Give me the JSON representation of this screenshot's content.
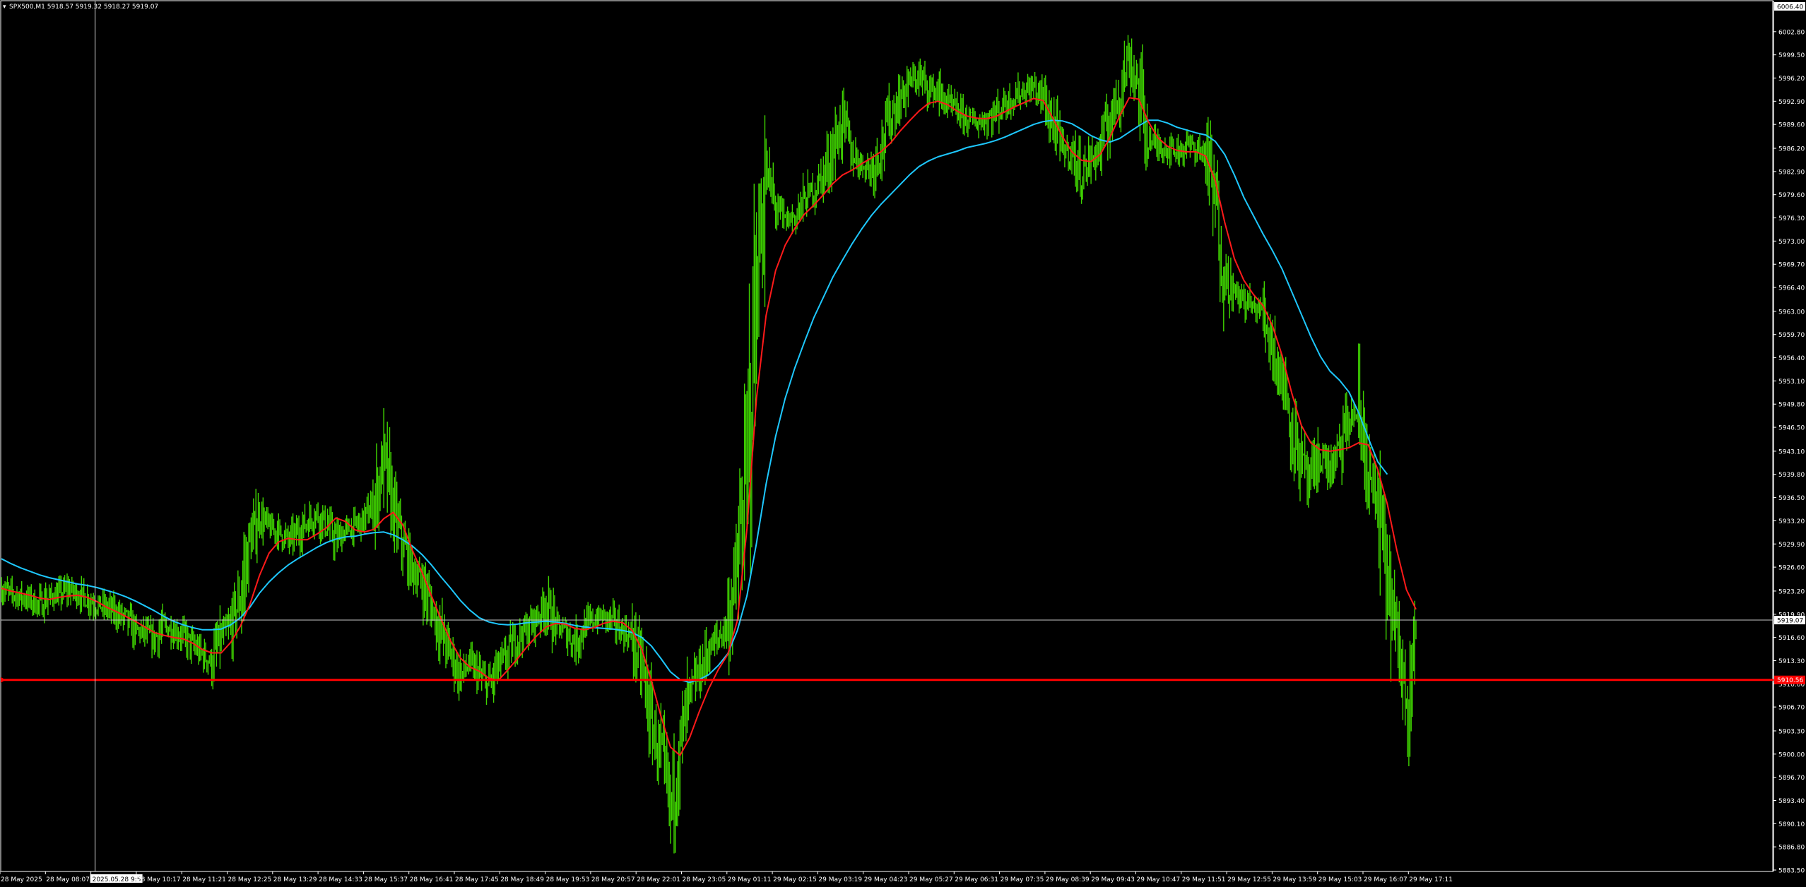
{
  "window": {
    "symbol_title": "SPX500,M1  5918.57 5919.32 5918.27 5919.07",
    "menu_glyph": "▾"
  },
  "colors": {
    "background": "#000000",
    "frame": "#ffffff",
    "candles": "#3fd400",
    "ma_fast": "#ff1a1a",
    "ma_slow": "#1ec8ff",
    "level_line": "#ff0000",
    "crosshair": "#d8d8d8"
  },
  "chart_data": {
    "type": "line",
    "title": "",
    "xlabel": "",
    "ylabel": "",
    "ylim": [
      5883.5,
      6006.4
    ],
    "grid": false,
    "y_ticks": [
      "6002.80",
      "5999.50",
      "5996.20",
      "5992.90",
      "5989.60",
      "5986.20",
      "5982.90",
      "5979.60",
      "5976.30",
      "5973.00",
      "5969.70",
      "5966.40",
      "5963.00",
      "5959.70",
      "5956.40",
      "5953.10",
      "5949.80",
      "5946.50",
      "5943.10",
      "5939.80",
      "5936.50",
      "5933.20",
      "5929.90",
      "5926.60",
      "5923.20",
      "5919.90",
      "5916.60",
      "5913.30",
      "5910.00",
      "5906.70",
      "5903.30",
      "5900.00",
      "5896.70",
      "5893.40",
      "5890.10",
      "5886.80",
      "5883.50"
    ],
    "x_ticks": [
      "28 May 2025",
      "28 May 08:07",
      "2025.05.28 9:51",
      "28 May 10:17",
      "28 May 11:21",
      "28 May 12:25",
      "28 May 13:29",
      "28 May 14:33",
      "28 May 15:37",
      "28 May 16:41",
      "28 May 17:45",
      "28 May 18:49",
      "28 May 19:53",
      "28 May 20:57",
      "28 May 22:01",
      "28 May 23:05",
      "29 May 01:11",
      "29 May 02:15",
      "29 May 03:19",
      "29 May 04:23",
      "29 May 05:27",
      "29 May 06:31",
      "29 May 07:35",
      "29 May 08:39",
      "29 May 09:43",
      "29 May 10:47",
      "29 May 11:51",
      "29 May 12:55",
      "29 May 13:59",
      "29 May 15:03",
      "29 May 16:07",
      "29 May 17:11"
    ],
    "crosshair_time_label": "2025.05.28 9:51",
    "top_price_label": "6006.40",
    "current_price_label": "5919.07",
    "level_price_label": "5910.56",
    "series": [
      {
        "name": "price",
        "values": [
          5923.5,
          5922.8,
          5922.4,
          5921.9,
          5921.2,
          5922.4,
          5922.6,
          5923.4,
          5922.8,
          5922.1,
          5921.3,
          5920.8,
          5920.1,
          5919.2,
          5917.6,
          5917.2,
          5916.4,
          5918.2,
          5917.6,
          5916.8,
          5915.4,
          5914.2,
          5913.1,
          5916.6,
          5918.2,
          5922.4,
          5930.2,
          5933.8,
          5932.2,
          5931.6,
          5930.4,
          5931.5,
          5933.1,
          5934.2,
          5932.6,
          5930.5,
          5931.8,
          5932.4,
          5933.4,
          5935.6,
          5941.8,
          5934.6,
          5929.8,
          5926.2,
          5924.4,
          5920.8,
          5917.4,
          5914.3,
          5911.2,
          5912.8,
          5911.2,
          5909.6,
          5912.4,
          5914.2,
          5916.6,
          5917.8,
          5919.4,
          5921.3,
          5918.2,
          5917.4,
          5915.9,
          5918.1,
          5919.2,
          5919.6,
          5918.8,
          5917.5,
          5916.6,
          5912.2,
          5904.5,
          5899.4,
          5892.3,
          5901.3,
          5908.2,
          5911.5,
          5914.7,
          5916.5,
          5918.6,
          5926.2,
          5940.6,
          5966.5,
          5982.6,
          5977.8,
          5975.8,
          5976.6,
          5978.8,
          5980.4,
          5982.4,
          5985.9,
          5990.1,
          5985.4,
          5984.1,
          5983.2,
          5986.4,
          5990.6,
          5993.2,
          5995.6,
          5996.3,
          5994.8,
          5994.2,
          5992.4,
          5991.3,
          5990.5,
          5989.8,
          5990.3,
          5991.2,
          5992.6,
          5993.6,
          5994.4,
          5994.8,
          5993.4,
          5989.6,
          5986.2,
          5985.3,
          5982.4,
          5984.6,
          5986.2,
          5990.5,
          5994.5,
          5999.1,
          5994.6,
          5987.5,
          5986.4,
          5986.2,
          5985.8,
          5986.7,
          5986.2,
          5985.4,
          5978.4,
          5968.4,
          5965.4,
          5964.8,
          5963.4,
          5963.2,
          5958.1,
          5953.3,
          5946.8,
          5941.6,
          5937.8,
          5942.6,
          5940.4,
          5943.1,
          5947.5,
          5948.6,
          5940.2,
          5934.8,
          5925.2,
          5915.6,
          5908.6,
          5919.07
        ]
      },
      {
        "name": "ma_fast",
        "values": [
          5923.6,
          5923.2,
          5922.9,
          5922.6,
          5922.2,
          5922.0,
          5922.3,
          5922.5,
          5922.6,
          5922.3,
          5921.7,
          5920.9,
          5920.3,
          5919.6,
          5918.9,
          5918.1,
          5917.3,
          5916.9,
          5916.6,
          5916.4,
          5915.8,
          5914.9,
          5914.4,
          5914.4,
          5915.9,
          5918.2,
          5921.3,
          5925.4,
          5928.6,
          5930.2,
          5930.7,
          5930.5,
          5930.5,
          5931.3,
          5932.2,
          5933.6,
          5933.1,
          5931.9,
          5931.6,
          5932.0,
          5933.5,
          5934.4,
          5932.6,
          5929.0,
          5925.9,
          5922.5,
          5919.2,
          5916.1,
          5913.7,
          5912.4,
          5911.8,
          5910.8,
          5910.5,
          5912.0,
          5913.6,
          5915.3,
          5916.8,
          5918.1,
          5918.6,
          5918.5,
          5917.9,
          5917.7,
          5918.0,
          5918.6,
          5918.9,
          5918.7,
          5917.6,
          5914.9,
          5910.5,
          5905.4,
          5901.0,
          5899.8,
          5902.3,
          5906.0,
          5909.3,
          5912.0,
          5914.2,
          5919.0,
          5932.0,
          5950.6,
          5962.4,
          5968.8,
          5972.4,
          5974.8,
          5976.8,
          5978.1,
          5979.6,
          5981.2,
          5982.4,
          5983.1,
          5984.0,
          5984.8,
          5985.7,
          5986.9,
          5988.6,
          5990.1,
          5991.5,
          5992.6,
          5992.9,
          5992.4,
          5991.5,
          5990.8,
          5990.5,
          5990.4,
          5990.7,
          5991.4,
          5992.1,
          5992.7,
          5993.3,
          5993.0,
          5990.5,
          5987.9,
          5985.7,
          5984.5,
          5984.3,
          5985.4,
          5987.8,
          5990.8,
          5993.4,
          5993.2,
          5990.0,
          5987.7,
          5986.5,
          5985.9,
          5985.7,
          5985.7,
          5985.1,
          5981.6,
          5975.6,
          5970.5,
          5967.4,
          5965.4,
          5963.8,
          5960.9,
          5956.7,
          5951.4,
          5946.8,
          5944.3,
          5943.3,
          5943.1,
          5943.3,
          5943.6,
          5944.3,
          5944.0,
          5940.5,
          5935.6,
          5929.0,
          5923.4,
          5920.6
        ]
      },
      {
        "name": "ma_slow",
        "values": [
          5927.8,
          5927.1,
          5926.5,
          5926.0,
          5925.5,
          5925.1,
          5924.8,
          5924.5,
          5924.2,
          5924.0,
          5923.7,
          5923.3,
          5922.9,
          5922.4,
          5921.8,
          5921.1,
          5920.4,
          5919.6,
          5918.9,
          5918.4,
          5918.0,
          5917.7,
          5917.7,
          5917.8,
          5918.4,
          5919.4,
          5920.9,
          5922.9,
          5924.5,
          5925.8,
          5926.9,
          5927.8,
          5928.6,
          5929.4,
          5930.1,
          5930.6,
          5930.9,
          5931.0,
          5931.3,
          5931.5,
          5931.6,
          5931.2,
          5930.5,
          5929.6,
          5928.4,
          5926.9,
          5925.2,
          5923.6,
          5921.9,
          5920.5,
          5919.4,
          5918.8,
          5918.5,
          5918.4,
          5918.5,
          5918.7,
          5918.8,
          5918.9,
          5918.8,
          5918.6,
          5918.3,
          5918.1,
          5918.0,
          5917.9,
          5917.8,
          5917.6,
          5917.3,
          5916.6,
          5915.4,
          5913.6,
          5911.7,
          5910.6,
          5910.2,
          5910.6,
          5911.3,
          5912.6,
          5914.3,
          5917.6,
          5922.5,
          5930.0,
          5938.4,
          5945.2,
          5950.6,
          5954.9,
          5958.6,
          5962.1,
          5965.0,
          5967.9,
          5970.3,
          5972.6,
          5974.7,
          5976.6,
          5978.2,
          5979.6,
          5981.0,
          5982.4,
          5983.6,
          5984.4,
          5985.0,
          5985.4,
          5985.8,
          5986.3,
          5986.6,
          5986.9,
          5987.3,
          5987.8,
          5988.4,
          5989.0,
          5989.6,
          5990.0,
          5990.2,
          5990.1,
          5989.7,
          5988.9,
          5988.0,
          5987.4,
          5987.1,
          5987.6,
          5988.5,
          5989.4,
          5990.2,
          5990.2,
          5989.8,
          5989.2,
          5988.8,
          5988.4,
          5988.1,
          5987.2,
          5985.3,
          5982.4,
          5979.2,
          5976.6,
          5974.0,
          5971.6,
          5969.0,
          5965.8,
          5962.6,
          5959.4,
          5956.6,
          5954.5,
          5953.2,
          5951.5,
          5948.6,
          5945.0,
          5941.6,
          5939.8
        ]
      }
    ],
    "level_line": 5910.56
  }
}
